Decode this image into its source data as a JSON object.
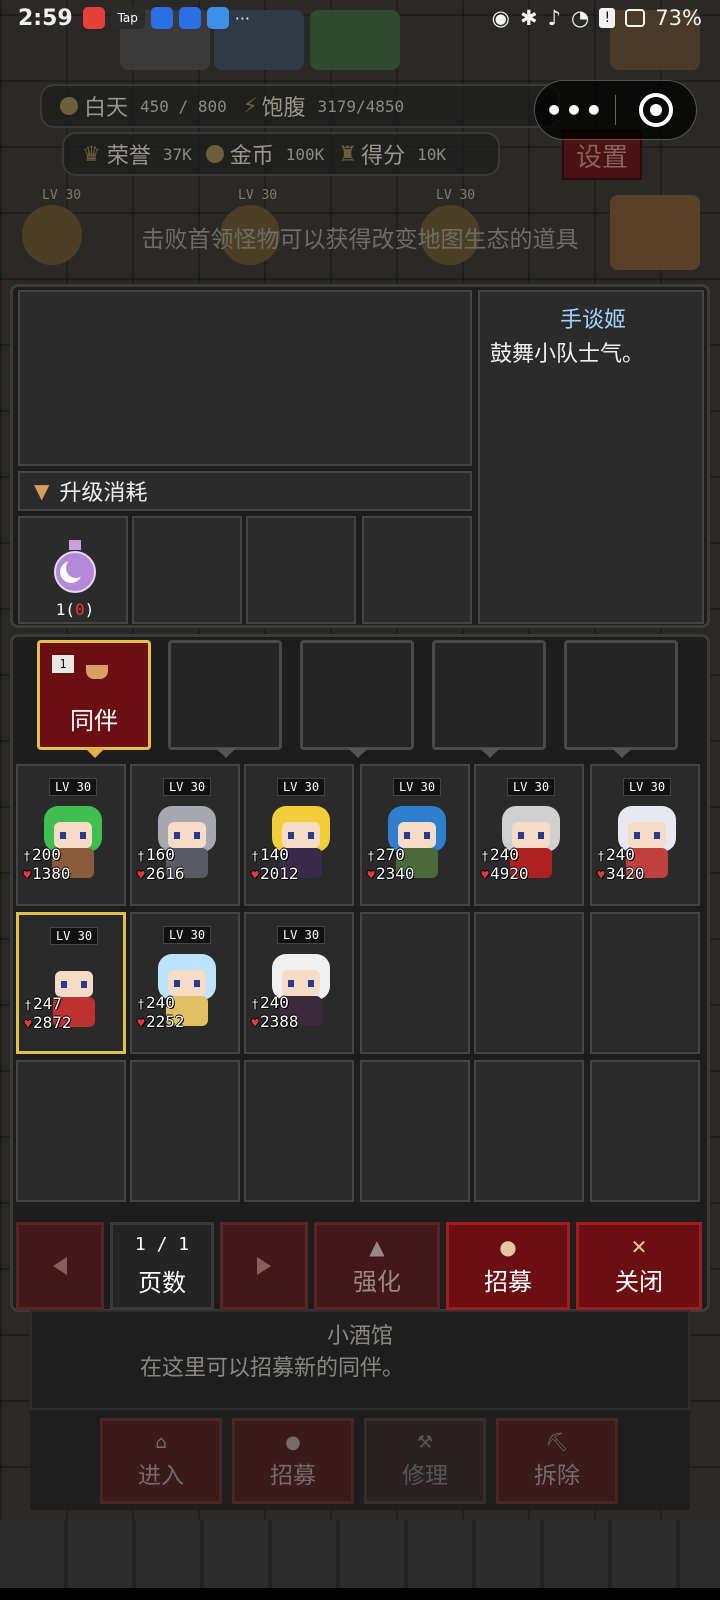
{
  "status_bar": {
    "time": "2:59",
    "battery": "73%",
    "apps": [
      "huawei-app-icon",
      "tap-app-icon",
      "circle-app-icon",
      "circle-app-icon-2",
      "shield-app-icon"
    ],
    "more": "···"
  },
  "hud": {
    "day_label": "白天",
    "day_value": "450 / 800",
    "satiety_label": "饱腹",
    "satiety_value": "3179/4850",
    "honor_label": "荣誉",
    "honor_value": "37K",
    "gold_label": "金币",
    "gold_value": "100K",
    "score_label": "得分",
    "score_value": "10K",
    "settings_label": "设置",
    "capsule_more": "•••",
    "map_levels": [
      "LV 30",
      "LV 30",
      "LV 30"
    ]
  },
  "tip": "击败首领怪物可以获得改变地图生态的道具",
  "info_panel": {
    "upgrade_label": "升级消耗",
    "potion_qty": "1(",
    "potion_qty_red": "0",
    "potion_qty_end": ")",
    "hero_name": "手谈姬",
    "hero_desc": "鼓舞小队士气。"
  },
  "party_slots": {
    "active_label": "同伴",
    "active_index": "1"
  },
  "heroes": [
    {
      "lv": "LV 30",
      "atk": "200",
      "hp": "1380",
      "hair": "#3fbf4f",
      "outfit": "#8a5a3a"
    },
    {
      "lv": "LV 30",
      "atk": "160",
      "hp": "2616",
      "hair": "#a8a8b0",
      "outfit": "#5a5a64"
    },
    {
      "lv": "LV 30",
      "atk": "140",
      "hp": "2012",
      "hair": "#f2cf3a",
      "outfit": "#3a2a4a"
    },
    {
      "lv": "LV 30",
      "atk": "270",
      "hp": "2340",
      "hair": "#2f7fd0",
      "outfit": "#4a6a3a"
    },
    {
      "lv": "LV 30",
      "atk": "240",
      "hp": "4920",
      "hair": "#d0d0d0",
      "outfit": "#b02020"
    },
    {
      "lv": "LV 30",
      "atk": "240",
      "hp": "3420",
      "hair": "#e8e8f0",
      "outfit": "#c04040"
    },
    {
      "lv": "LV 30",
      "atk": "247",
      "hp": "2872",
      "hair": "#2a2a2a",
      "outfit": "#c03030"
    },
    {
      "lv": "LV 30",
      "atk": "240",
      "hp": "2252",
      "hair": "#bfe2ff",
      "outfit": "#e0c060"
    },
    {
      "lv": "LV 30",
      "atk": "240",
      "hp": "2388",
      "hair": "#f0f0f0",
      "outfit": "#3a2a3a"
    }
  ],
  "controls": {
    "pages": "1 / 1",
    "pages_label": "页数",
    "enhance": "强化",
    "recruit": "招募",
    "close": "关闭"
  },
  "building": {
    "name": "小酒馆",
    "desc": "在这里可以招募新的同伴。",
    "enter": "进入",
    "recruit": "招募",
    "repair": "修理",
    "demolish": "拆除"
  },
  "colors": {
    "accent_red": "#6b0f12",
    "gold_border": "#e2c04a",
    "hero_name": "#9fd6ff",
    "hp_heart": "#e83a3a"
  }
}
